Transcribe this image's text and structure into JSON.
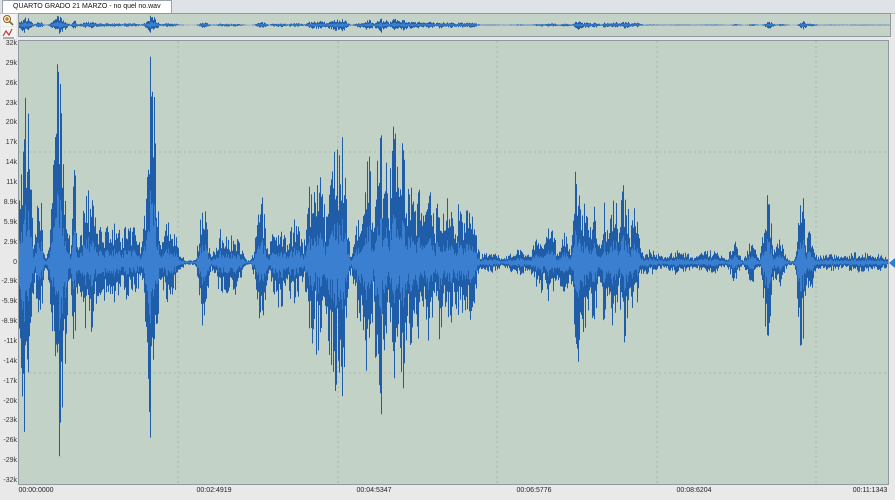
{
  "tab": {
    "title": "QUARTO GRADO 21  MARZO - no quel no.wav"
  },
  "tools": {
    "zoom_in": "zoom-in-icon",
    "zoom_fit": "zoom-fit-icon"
  },
  "colors": {
    "waveform": "#1f5da8",
    "waveform_light": "#3b7fd0",
    "background": "#c3d2c6",
    "gridline": "#a9b8ae"
  },
  "y_axis": {
    "labels": [
      "32k",
      "29k",
      "26k",
      "23k",
      "20k",
      "17k",
      "14k",
      "11k",
      "8.9k",
      "5.9k",
      "2.9k",
      "0",
      "-2.9k",
      "-5.9k",
      "-8.9k",
      "-11k",
      "-14k",
      "-17k",
      "-20k",
      "-23k",
      "-26k",
      "-29k",
      "-32k"
    ]
  },
  "x_axis": {
    "labels": [
      "00:00:0000",
      "00:02:4919",
      "00:04:5347",
      "00:06:5776",
      "00:08:6204",
      "00:11:1343"
    ]
  }
}
